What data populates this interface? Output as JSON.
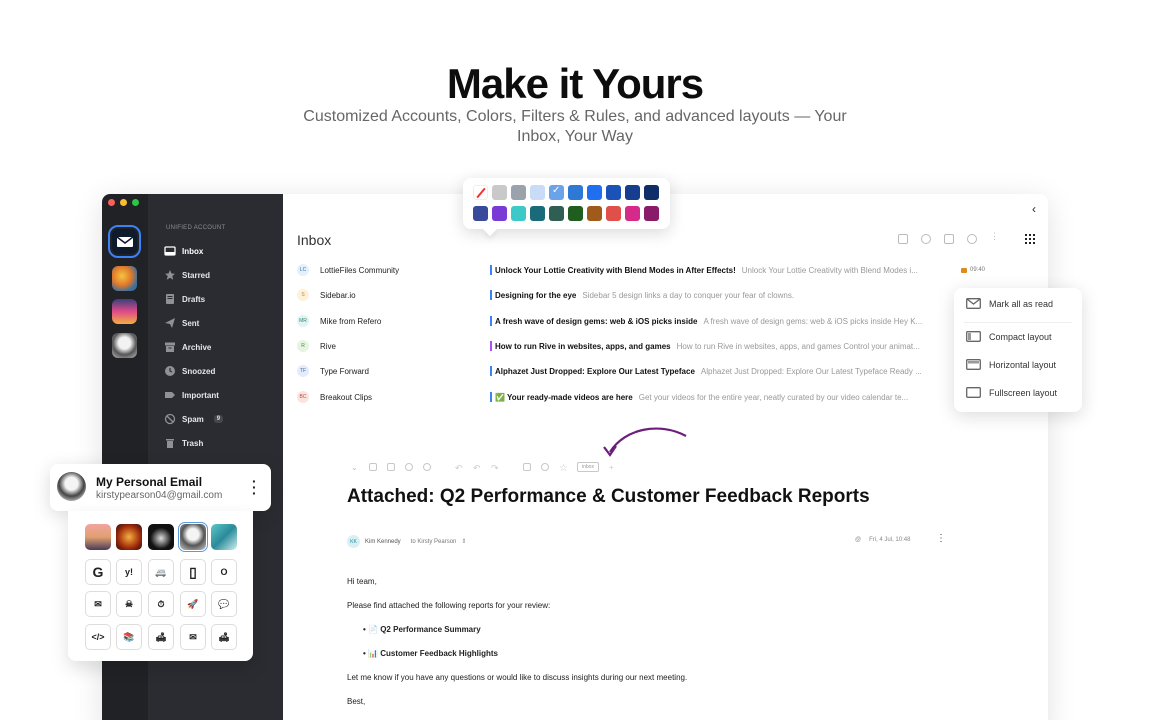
{
  "hero": {
    "title": "Make it Yours",
    "subtitle": "Customized Accounts, Colors, Filters & Rules, and advanced layouts — Your Inbox, Your Way"
  },
  "sidebar": {
    "account_label": "UNIFIED ACCOUNT",
    "items": [
      {
        "label": "Inbox",
        "icon": "inbox-icon"
      },
      {
        "label": "Starred",
        "icon": "star-icon"
      },
      {
        "label": "Drafts",
        "icon": "drafts-icon"
      },
      {
        "label": "Sent",
        "icon": "sent-icon"
      },
      {
        "label": "Archive",
        "icon": "archive-icon"
      },
      {
        "label": "Snoozed",
        "icon": "clock-icon"
      },
      {
        "label": "Important",
        "icon": "tag-icon"
      },
      {
        "label": "Spam",
        "icon": "spam-icon",
        "badge": "9"
      },
      {
        "label": "Trash",
        "icon": "trash-icon"
      }
    ]
  },
  "main": {
    "title": "Inbox",
    "messages": [
      {
        "initials": "LC",
        "sender": "LottieFiles Community",
        "subject": "Unlock Your Lottie Creativity with Blend Modes in After Effects!",
        "preview": "Unlock Your Lottie Creativity with Blend Modes i...",
        "time": "09:40",
        "bar_color": "#3b82f6"
      },
      {
        "initials": "S",
        "sender": "Sidebar.io",
        "subject": "Designing for the eye",
        "preview": "Sidebar 5 design links a day to conquer your fear of clowns.",
        "time": "",
        "bar_color": "#3b82f6"
      },
      {
        "initials": "MR",
        "sender": "Mike from Refero",
        "subject": "A fresh wave of design gems: web & iOS picks inside",
        "preview": "A fresh wave of design gems: web & iOS picks inside Hey K...",
        "time": "",
        "bar_color": "#3b82f6"
      },
      {
        "initials": "R",
        "sender": "Rive",
        "subject": "How to run Rive in websites, apps, and games",
        "preview": "How to run Rive in websites, apps, and games Control your animat...",
        "time": "",
        "bar_color": "#a855f7"
      },
      {
        "initials": "TF",
        "sender": "Type Forward",
        "subject": "Alphazet Just Dropped: Explore Our Latest Typeface",
        "preview": "Alphazet Just Dropped: Explore Our Latest Typeface Ready ...",
        "time": "",
        "bar_color": "#3b82f6"
      },
      {
        "initials": "BC",
        "sender": "Breakout Clips",
        "subject": "✅  Your ready-made videos are here",
        "preview": "Get your videos for the entire year, neatly curated by our video calendar te...",
        "time": "",
        "bar_color": "#3b82f6"
      }
    ],
    "reader": {
      "inbox_pill": "inbox",
      "subject": "Attached: Q2 Performance & Customer Feedback Reports",
      "from_initials": "KK",
      "from": "Kim Kennedy",
      "to": "to Kirsty Pearson",
      "date": "Fri, 4 Jul, 10:48",
      "body": {
        "greeting": "Hi team,",
        "line1": "Please find attached the following reports for your review:",
        "bullet1": "• 📄 Q2 Performance Summary",
        "bullet2": "• 📊 Customer Feedback Highlights",
        "line2": "Let me know if you have any questions or would like to discuss insights during our next meeting.",
        "closing": "Best,"
      }
    }
  },
  "layout_menu": {
    "items": [
      {
        "label": "Mark all as read",
        "icon": "envelope-icon"
      },
      {
        "label": "Compact layout",
        "icon": "compact-layout-icon"
      },
      {
        "label": "Horizontal layout",
        "icon": "horizontal-layout-icon"
      },
      {
        "label": "Fullscreen layout",
        "icon": "fullscreen-layout-icon"
      }
    ]
  },
  "color_palette": {
    "row1": [
      "none",
      "#c9c9c9",
      "#9aa3ab",
      "#c9dcf7",
      "#6aa3e8",
      "#2f79d6",
      "#1f6ff0",
      "#1a52b8",
      "#163d8e",
      "#0f2d66"
    ],
    "row2": [
      "#3a4a9a",
      "#7a3ad6",
      "#3ec9c9",
      "#1a6b7a",
      "#2f5e52",
      "#1f5e1f",
      "#a05a1a",
      "#e0504a",
      "#d62a8a",
      "#8a1a6a"
    ],
    "selected": "#6aa3e8"
  },
  "account_card": {
    "name": "My Personal Email",
    "email": "kirstypearson04@gmail.com"
  },
  "icon_picker": {
    "row2_glyphs": [
      "G",
      "y!",
      "🚐",
      "▯",
      "O"
    ],
    "row3_glyphs": [
      "✉",
      "☠",
      "⏱",
      "🚀",
      "💬"
    ],
    "row4_glyphs": [
      "</>",
      "📚",
      "🛋",
      "✉",
      "🛋"
    ]
  },
  "colors": {
    "accent": "#3b82f6",
    "sidebar_bg": "#2a2c31",
    "rail_bg": "#202226"
  }
}
